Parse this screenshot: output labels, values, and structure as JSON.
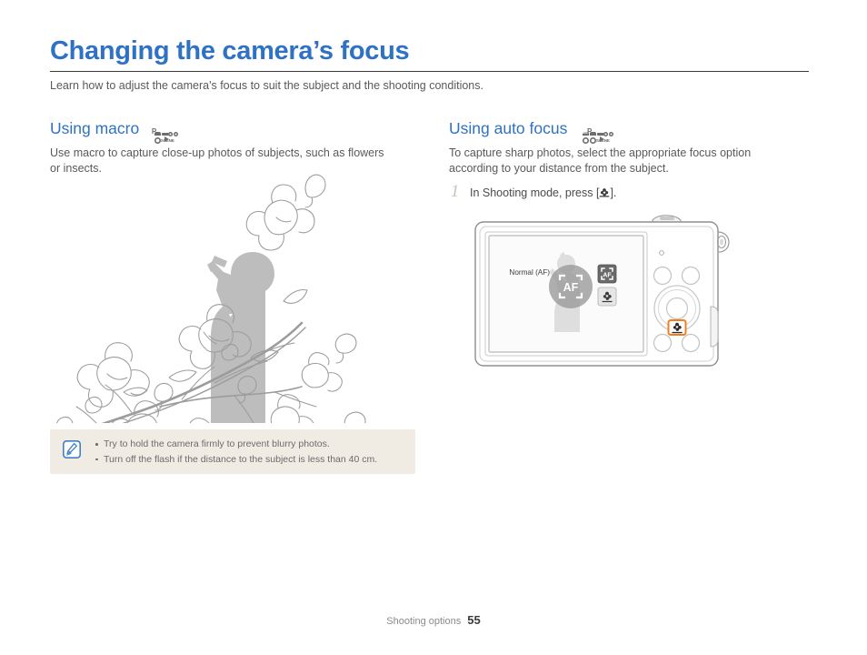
{
  "document": {
    "title": "Changing the camera’s focus",
    "intro": "Learn how to adjust the camera's focus to suit the subject and the shooting conditions.",
    "title_color": "#2f72c4"
  },
  "sections": {
    "left": {
      "heading": "Using macro",
      "mode_icons": [
        "camera-program-icon",
        "scene-mode-icon",
        "movie-mode-icon"
      ],
      "mode_icon_labels": [
        "P",
        "SCENE",
        ""
      ],
      "body": "Use macro to capture close-up photos of subjects, such as flowers or insects.",
      "illustration": "magnolia-branch-photographer-illustration"
    },
    "right": {
      "heading": "Using auto focus",
      "mode_icons": [
        "smart-auto-icon",
        "camera-program-icon",
        "scene-mode-icon",
        "movie-mode-icon"
      ],
      "mode_icon_labels": [
        "SMART",
        "P",
        "SCENE",
        ""
      ],
      "body": "To capture sharp photos, select the appropriate focus option according to your distance from the subject.",
      "steps": [
        {
          "number": "1",
          "text_before": "In Shooting mode, press [",
          "text_after": "]."
        }
      ]
    }
  },
  "camera_illustration": {
    "name": "camera-rear-view",
    "lcd": {
      "option_label": "Normal (AF)",
      "selected_option_icon": "af-icon",
      "options": [
        {
          "icon": "af-icon",
          "label": "AF",
          "state": "selected"
        },
        {
          "icon": "macro-flower-icon",
          "label": "",
          "state": "unselected"
        }
      ]
    },
    "highlighted_button": "macro-button",
    "highlight_color": "#ef7f1f"
  },
  "note": {
    "icon": "note-pencil-icon",
    "background": "#f0ece4",
    "items": [
      "Try to hold the camera firmly to prevent blurry photos.",
      "Turn off the flash if the distance to the subject is less than 40 cm."
    ]
  },
  "footer": {
    "label": "Shooting options",
    "page_number": "55"
  }
}
